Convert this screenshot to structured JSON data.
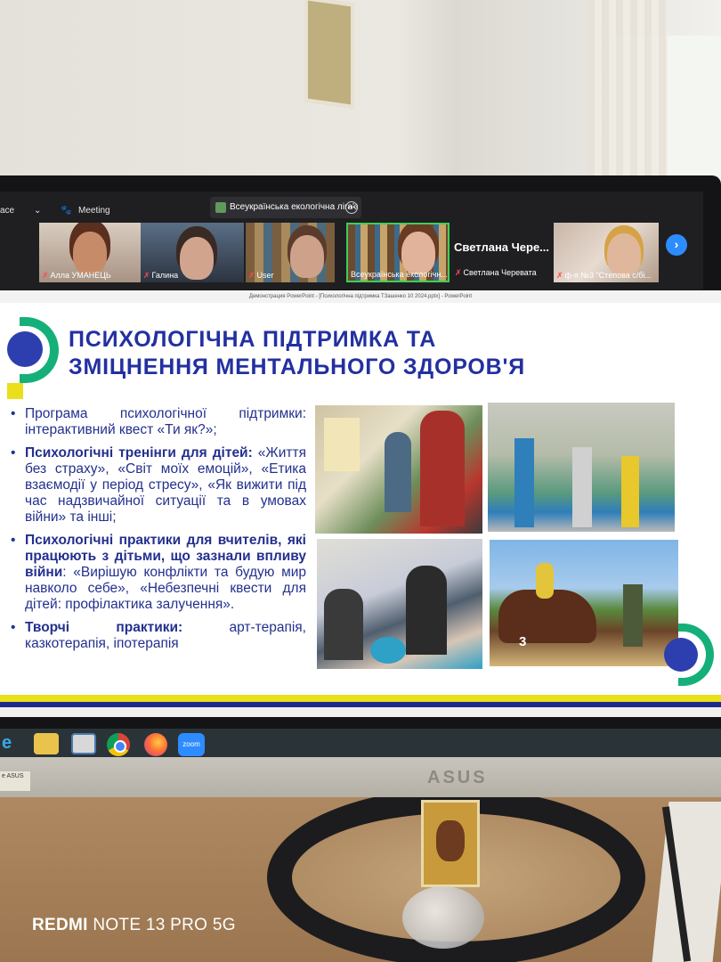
{
  "zoom": {
    "left_label": "ace",
    "meeting_label": "Meeting",
    "meeting_chip": "Всеукраїнська екологічна ліга'з",
    "speaker_name": "Светлана  Чере...",
    "participants": [
      {
        "name": "Алла УМАНЕЦЬ"
      },
      {
        "name": "Галина"
      },
      {
        "name": "User"
      },
      {
        "name": "Всеукраїнська екологічн..."
      },
      {
        "name": "Светлана Черевата"
      },
      {
        "name": "ф-я №3 \"Степова с/бі..."
      }
    ],
    "next_arrow": "›"
  },
  "powerpoint": {
    "window_title": "Демонстрация PowerPoint - [Психологічна підтримка ТЗашенко 10 2024.pptx] - PowerPoint"
  },
  "slide": {
    "title_line1": "ПСИХОЛОГІЧНА ПІДТРИМКА ТА",
    "title_line2": "ЗМІЦНЕННЯ МЕНТАЛЬНОГО ЗДОРОВ'Я",
    "bullets": [
      {
        "bold": "",
        "text": "Програма психологічної підтримки: інтерактивний квест «Ти як?»;"
      },
      {
        "bold": "Психологічні тренінги для дітей:",
        "text": " «Життя без страху», «Світ моїх емоцій», «Етика взаємодії у період стресу», «Як вижити під час надзвичайної ситуації та в умовах війни» та інші;"
      },
      {
        "bold": "Психологічні практики для вчителів, які працюють з дітьми, що зазнали впливу війни",
        "text": ": «Вирішую конфлікти та будую мир навколо себе», «Небезпечні квести для дітей: профілактика залучення»."
      },
      {
        "bold": "Творчі практики:",
        "text": " арт-терапія, казкотерапія, іпотерапія"
      }
    ],
    "photo_number": "3"
  },
  "taskbar": {
    "zoom_label": "zoom",
    "ie_glyph": "e"
  },
  "monitor": {
    "brand": "ASUS",
    "sticker": "e ASUS"
  },
  "camera": {
    "watermark_bold": "REDMI",
    "watermark_rest": " NOTE 13 PRO 5G"
  },
  "colors": {
    "title_blue": "#2230a0",
    "accent_green": "#15b07a",
    "accent_yellow": "#e9df1b",
    "zoom_active": "#3fcf55",
    "zoom_blue": "#2d8cff"
  }
}
